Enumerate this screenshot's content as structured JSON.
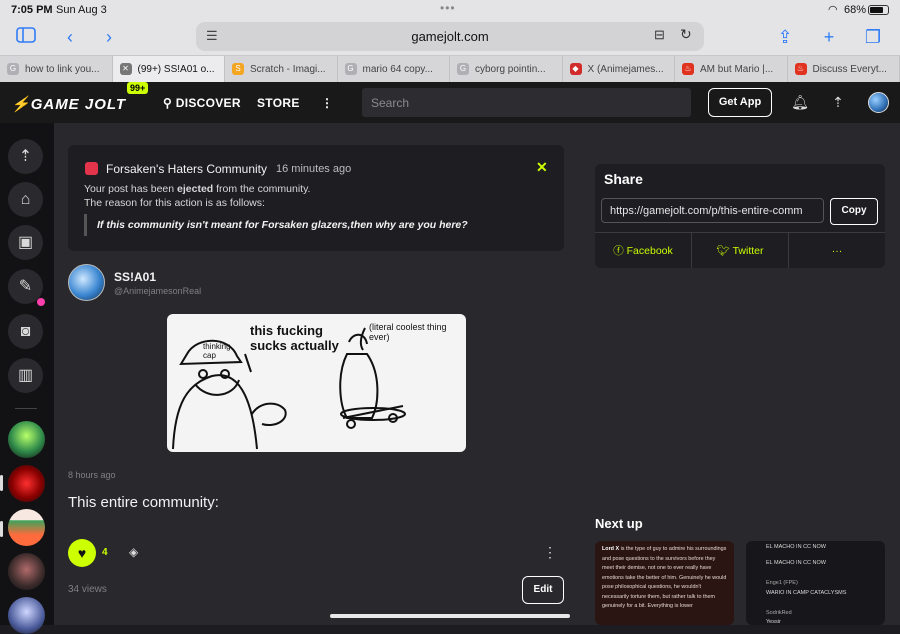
{
  "status": {
    "time": "7:05 PM",
    "date": "Sun Aug 3",
    "battery": "68%"
  },
  "browser": {
    "url": "gamejolt.com",
    "tabs": [
      {
        "label": "how to link you...",
        "favicon": "G"
      },
      {
        "label": "(99+) SS!A01 o...",
        "favicon": "✕"
      },
      {
        "label": "Scratch - Imagi...",
        "favicon": "S"
      },
      {
        "label": "mario 64 copy...",
        "favicon": "G"
      },
      {
        "label": "cyborg pointin...",
        "favicon": "G"
      },
      {
        "label": "X (Animejames...",
        "favicon": "◆"
      },
      {
        "label": "AM but Mario |...",
        "favicon": "♨"
      },
      {
        "label": "Discuss Everyt...",
        "favicon": "♨"
      }
    ]
  },
  "header": {
    "logo": "GAME JOLT",
    "notif": "99+",
    "discover": "DISCOVER",
    "store": "STORE",
    "search_placeholder": "Search",
    "get_app": "Get App"
  },
  "ejected": {
    "community": "Forsaken's Haters Community",
    "time": "16 minutes ago",
    "line1_prefix": "Your post has been ",
    "line1_bold": "ejected",
    "line1_suffix": " from the community.",
    "line2": "The reason for this action is as follows:",
    "quote": "If this community isn't meant for Forsaken glazers,then why are you here?"
  },
  "post": {
    "name": "SS!A01",
    "handle": "@AnimejamesonReal",
    "comic_text": "this fucking sucks actually",
    "comic_caption": "(literal coolest thing ever)",
    "comic_cap": "thinking cap",
    "time": "8 hours ago",
    "body": "This entire community:",
    "likes": "4",
    "views": "34 views",
    "edit": "Edit"
  },
  "share": {
    "title": "Share",
    "url": "https://gamejolt.com/p/this-entire-comm",
    "copy": "Copy",
    "facebook": "Facebook",
    "twitter": "Twitter",
    "more": "···"
  },
  "nextup": {
    "title": "Next up",
    "card1_name": "Lord X",
    "card1_text": " is the type of guy to admire his surroundings and pose questions to the survivors before they meet their demise, not one to ever really have emotions take the better of him. Genuinely he would pose philosophical questions, he wouldn't necessarily torture them, but rather talk to them genuinely for a bit. Everything is lower",
    "card2_lines": [
      "EL MACHO IN CC NOW",
      "EL MACHO IN CC NOW",
      "Enge1 (FPE)",
      "WARIO IN CAMP CATACLYSMS",
      "SodrikRed",
      "Yessir"
    ]
  },
  "colors": {
    "accent": "#ccff00",
    "background": "#28282d",
    "panel": "#1d1d22"
  }
}
